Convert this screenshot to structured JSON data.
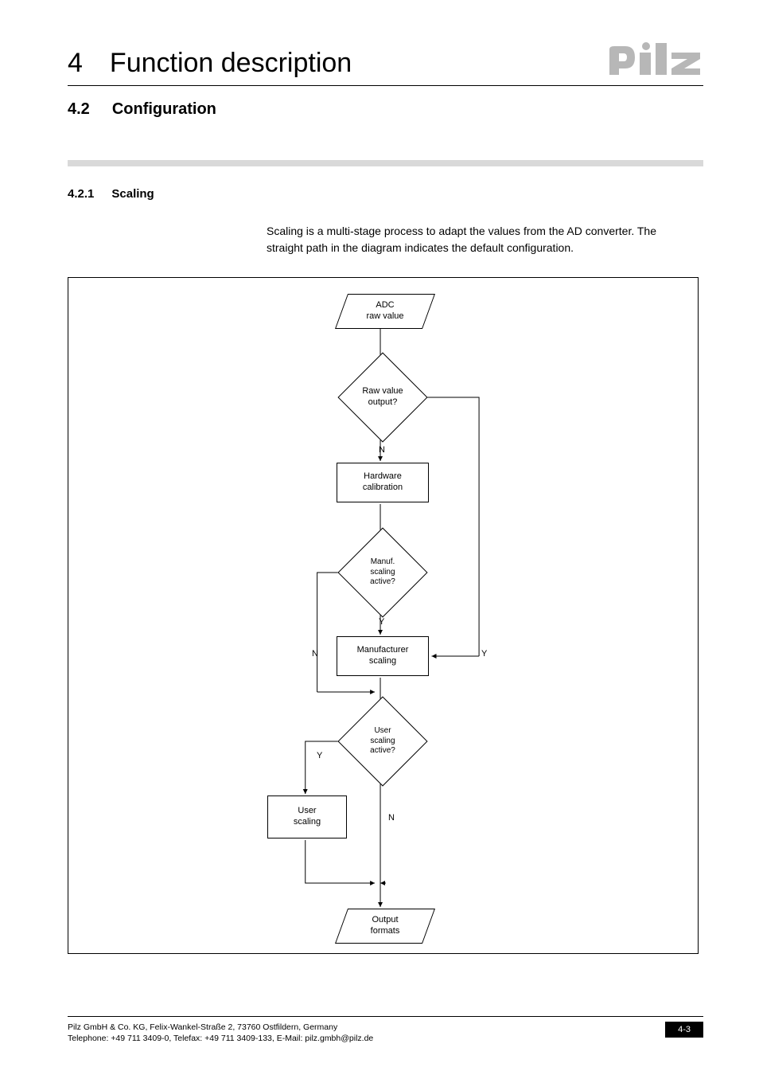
{
  "header": {
    "chapter_number": "4",
    "chapter_title": "Function description"
  },
  "section": {
    "number": "4.2",
    "title": "Configuration"
  },
  "subsection": {
    "number": "4.2.1",
    "title": "Scaling"
  },
  "body_paragraph": "Scaling is a multi-stage process to adapt the values from the AD converter. The straight path in the diagram indicates the default configuration.",
  "flowchart": {
    "node_adc_l1": "ADC",
    "node_adc_l2": "raw value",
    "node_rawq_l1": "Raw value",
    "node_rawq_l2": "output?",
    "node_hwcal_l1": "Hardware",
    "node_hwcal_l2": "calibration",
    "node_manufq_l1": "Manuf.",
    "node_manufq_l2": "scaling",
    "node_manufq_l3": "active?",
    "node_manuf_l1": "Manufacturer",
    "node_manuf_l2": "scaling",
    "node_userq_l1": "User",
    "node_userq_l2": "scaling",
    "node_userq_l3": "active?",
    "node_user_l1": "User",
    "node_user_l2": "scaling",
    "node_out_l1": "Output",
    "node_out_l2": "formats",
    "label_n1": "N",
    "label_y1": "Y",
    "label_n2": "N",
    "label_y2": "Y",
    "label_y3": "Y",
    "label_n3": "N"
  },
  "footer": {
    "line1": "Pilz GmbH & Co. KG, Felix-Wankel-Straße 2, 73760 Ostfildern, Germany",
    "line2": "Telephone: +49 711 3409-0, Telefax: +49 711 3409-133, E-Mail: pilz.gmbh@pilz.de",
    "page_number": "4-3"
  }
}
